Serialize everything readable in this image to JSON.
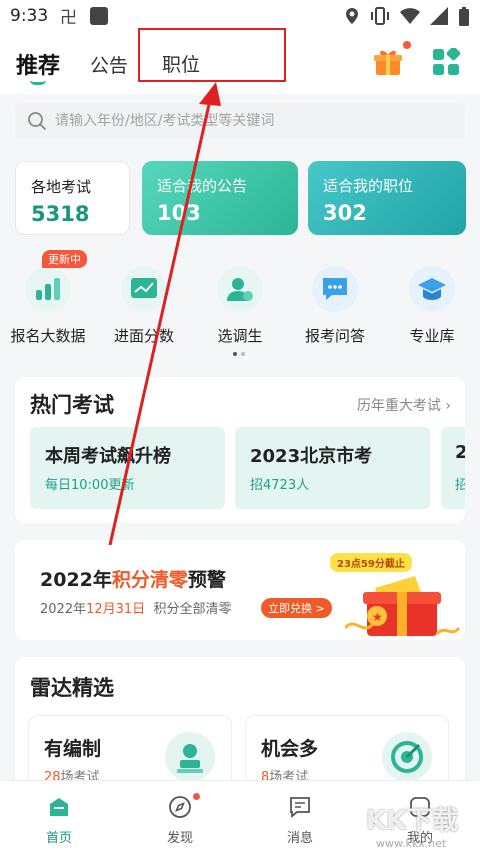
{
  "status": {
    "time": "9:33"
  },
  "header": {
    "tabs": [
      {
        "label": "推荐"
      },
      {
        "label": "公告"
      },
      {
        "label": "职位"
      }
    ]
  },
  "search": {
    "placeholder": "请输入年份/地区/考试类型等关键词"
  },
  "cards": [
    {
      "title": "各地考试",
      "value": "5318"
    },
    {
      "title": "适合我的公告",
      "value": "103"
    },
    {
      "title": "适合我的职位",
      "value": "302"
    }
  ],
  "quick_icons": [
    {
      "label": "报名大数据",
      "icon": "bar-chart-icon",
      "badge": "更新中"
    },
    {
      "label": "进面分数",
      "icon": "line-chart-icon"
    },
    {
      "label": "选调生",
      "icon": "person-icon"
    },
    {
      "label": "报考问答",
      "icon": "chat-icon"
    },
    {
      "label": "专业库",
      "icon": "graduation-cap-icon"
    }
  ],
  "hot_exams": {
    "title": "热门考试",
    "more": "历年重大考试",
    "items": [
      {
        "title": "本周考试飙升榜",
        "sub": "每日10:00更新"
      },
      {
        "title": "2023北京市考",
        "sub": "招4723人"
      },
      {
        "title": "2",
        "sub": "招"
      }
    ]
  },
  "promo": {
    "title_pre": "2022年",
    "title_red": "积分清零",
    "title_post": "预警",
    "sub_pre": "2022年",
    "sub_red": "12月31日",
    "sub_post": "积分全部清零",
    "button": "立即兑换 >",
    "tag": "23点59分截止"
  },
  "radar": {
    "title": "雷达精选",
    "items": [
      {
        "title": "有编制",
        "count": "28",
        "suffix": "场考试",
        "icon": "badge-person-icon"
      },
      {
        "title": "机会多",
        "count": "8",
        "suffix": "场考试",
        "icon": "target-icon"
      }
    ]
  },
  "tabbar": [
    {
      "label": "首页",
      "icon": "home-icon"
    },
    {
      "label": "发现",
      "icon": "compass-icon"
    },
    {
      "label": "消息",
      "icon": "message-icon"
    },
    {
      "label": "我的",
      "icon": "user-icon"
    }
  ],
  "watermark": {
    "main": "KK下载",
    "sub": "www.kkx.net"
  },
  "colors": {
    "accent": "#1fb89a",
    "red": "#f05a28",
    "annotation": "#e02020"
  }
}
